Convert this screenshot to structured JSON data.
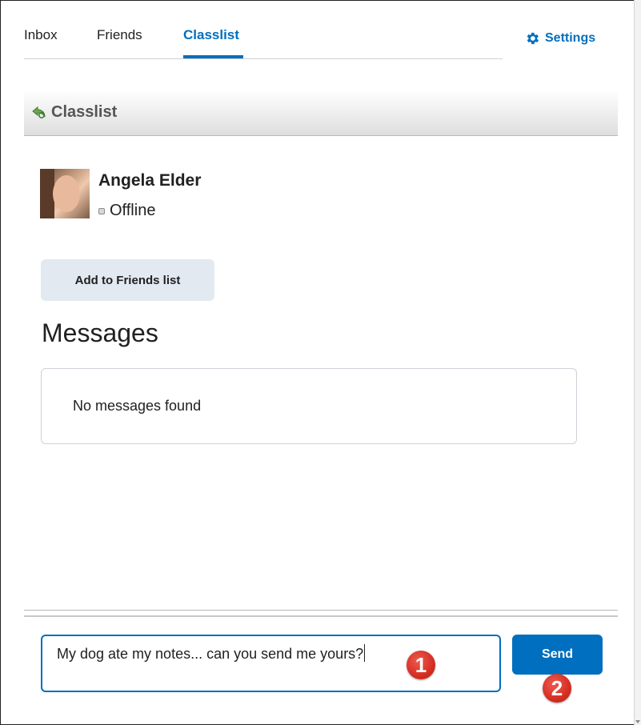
{
  "tabs": [
    {
      "label": "Inbox"
    },
    {
      "label": "Friends"
    },
    {
      "label": "Classlist",
      "active": true
    }
  ],
  "settings_label": "Settings",
  "back_bar": {
    "title": "Classlist"
  },
  "profile": {
    "name": "Angela Elder",
    "status": "Offline"
  },
  "add_friend_label": "Add to Friends list",
  "messages": {
    "heading": "Messages",
    "empty_text": "No messages found"
  },
  "composer": {
    "value": "My dog ate my notes... can you send me yours?",
    "send_label": "Send"
  },
  "annotations": [
    "1",
    "2"
  ],
  "colors": {
    "accent": "#006fbf",
    "badge": "#d52e22"
  }
}
